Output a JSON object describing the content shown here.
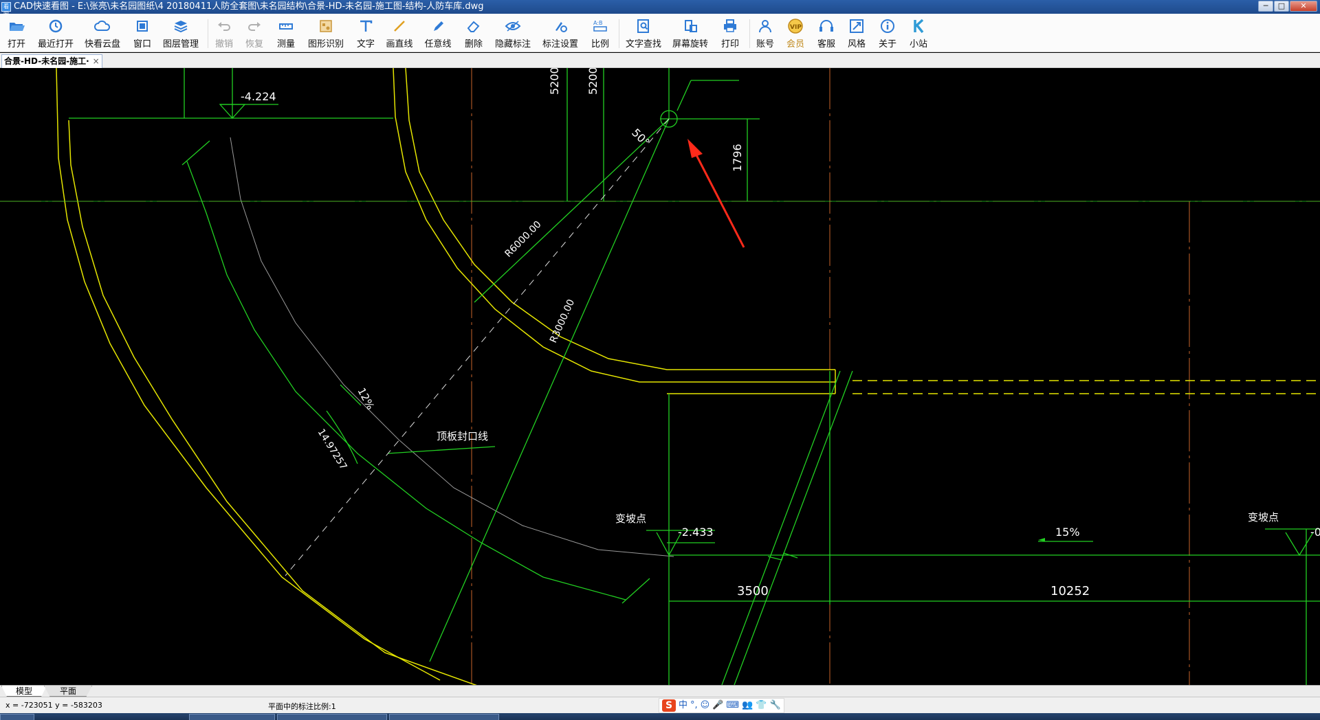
{
  "window": {
    "title": "CAD快速看图 - E:\\张亮\\未名园图纸\\4 20180411人防全套图\\未名园结构\\合景-HD-未名园-施工图-结构-人防车库.dwg",
    "app_icon_text": "看图",
    "buttons": {
      "minimize": "─",
      "maximize": "□",
      "close": "✕"
    }
  },
  "toolbar": {
    "items": [
      {
        "label": "打开",
        "icon": "folder-open-icon"
      },
      {
        "label": "最近打开",
        "icon": "history-icon"
      },
      {
        "label": "快看云盘",
        "icon": "cloud-icon"
      },
      {
        "label": "窗口",
        "icon": "window-icon"
      },
      {
        "label": "图层管理",
        "icon": "layers-icon"
      },
      {
        "label": "撤销",
        "icon": "undo-icon",
        "disabled": true
      },
      {
        "label": "恢复",
        "icon": "redo-icon",
        "disabled": true
      },
      {
        "label": "测量",
        "icon": "ruler-icon"
      },
      {
        "label": "图形识别",
        "icon": "shape-recognize-icon"
      },
      {
        "label": "文字",
        "icon": "text-icon"
      },
      {
        "label": "画直线",
        "icon": "line-icon"
      },
      {
        "label": "任意线",
        "icon": "pen-icon"
      },
      {
        "label": "删除",
        "icon": "eraser-icon"
      },
      {
        "label": "隐藏标注",
        "icon": "eye-icon"
      },
      {
        "label": "标注设置",
        "icon": "annotation-settings-icon"
      },
      {
        "label": "比例",
        "icon": "scale-icon"
      },
      {
        "label": "文字查找",
        "icon": "text-search-icon"
      },
      {
        "label": "屏幕旋转",
        "icon": "rotate-screen-icon"
      },
      {
        "label": "打印",
        "icon": "printer-icon"
      },
      {
        "label": "账号",
        "icon": "user-icon"
      },
      {
        "label": "会员",
        "icon": "vip-icon"
      },
      {
        "label": "客服",
        "icon": "headset-icon"
      },
      {
        "label": "风格",
        "icon": "style-icon"
      },
      {
        "label": "关于",
        "icon": "info-icon"
      },
      {
        "label": "小站",
        "icon": "k-logo-icon"
      }
    ]
  },
  "document_tab": {
    "label": "合景-HD-未名园-施工·",
    "close": "×"
  },
  "drawing": {
    "labels": {
      "level_top": "-4.224",
      "dim_5200_a": "5200",
      "dim_5200_b": "5200",
      "angle": "50°",
      "dim_1796": "1796",
      "radius_6000": "R6000.00",
      "radius_3000": "R3000.00",
      "slope_12": "12%",
      "arc_len": "14.97257",
      "roof_seal": "顶板封口线",
      "change_point_1": "变坡点",
      "level_mid": "-2.433",
      "slope_15": "15%",
      "change_point_2": "变坡点",
      "level_right": "-0",
      "dim_3500": "3500",
      "dim_10252": "10252"
    },
    "colors": {
      "yellow": "#e6e600",
      "green": "#22d022",
      "orange_grid": "#c8642a",
      "red_arrow": "#ff2a1a",
      "white": "#ffffff",
      "gray": "#9a9a9a"
    }
  },
  "layout_tabs": {
    "model": "模型",
    "plan": "平面"
  },
  "status": {
    "coords": "x = -723051  y = -583203",
    "scale": "平面中的标注比例:1"
  },
  "ime": {
    "logo": "S",
    "mode": "中",
    "punct": "°,",
    "emoji": "☺",
    "mic": "🎤",
    "keyboard": "⌨",
    "user": "👥",
    "shirt": "👕",
    "tool": "🔧"
  }
}
